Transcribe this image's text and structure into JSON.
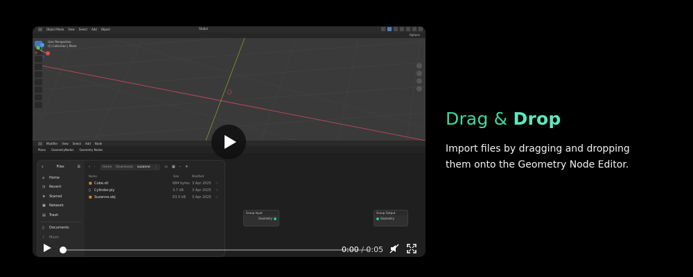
{
  "viewport": {
    "mode": "Object Mode",
    "menu": [
      "View",
      "Select",
      "Add",
      "Object"
    ],
    "transform": "Global",
    "options": "Options",
    "info_line1": "User Perspective",
    "info_line2": "(1) Collection | Plane"
  },
  "node_editor": {
    "mode": "Modifier",
    "menu": [
      "View",
      "Select",
      "Add",
      "Node"
    ],
    "breadcrumb": [
      "Plane",
      "GeometryNodes",
      "Geometry Nodes"
    ],
    "group_input": {
      "title": "Group Input",
      "socket": "Geometry"
    },
    "group_output": {
      "title": "Group Output",
      "socket": "Geometry"
    },
    "socket_color": "#20c997"
  },
  "file_dialog": {
    "sidebar_title": "Files",
    "sidebar_items": [
      {
        "icon": "home-icon",
        "label": "Home"
      },
      {
        "icon": "clock-icon",
        "label": "Recent"
      },
      {
        "icon": "star-icon",
        "label": "Starred"
      },
      {
        "icon": "network-icon",
        "label": "Network"
      },
      {
        "icon": "trash-icon",
        "label": "Trash"
      },
      {
        "icon": "document-icon",
        "label": "Documents"
      },
      {
        "icon": "music-icon",
        "label": "Music"
      }
    ],
    "path": [
      "Home",
      "Downloads",
      "suzanne"
    ],
    "columns": [
      "Name",
      "Size",
      "Modified"
    ],
    "files": [
      {
        "name": "Cube.stl",
        "size": "684 bytes",
        "modified": "3 Apr 2025"
      },
      {
        "name": "Cylinder.ply",
        "size": "3.7 kB",
        "modified": "3 Apr 2025"
      },
      {
        "name": "Suzanne.obj",
        "size": "63.0 kB",
        "modified": "3 Apr 2025"
      }
    ]
  },
  "player": {
    "current_time": "0:00",
    "separator": "/",
    "duration": "0:05",
    "progress": 0.0
  },
  "hero": {
    "title_light": "Drag &",
    "title_bold": "Drop",
    "description": "Import files by dragging and dropping them onto the Geometry Node Editor.",
    "accent": "#3fd9a3"
  }
}
